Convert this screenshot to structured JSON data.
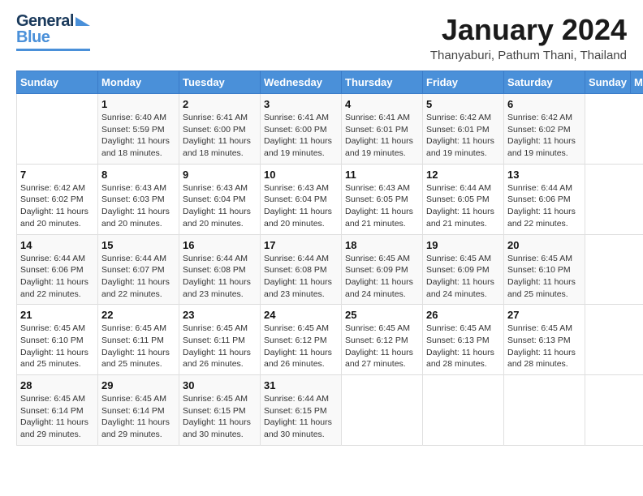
{
  "header": {
    "logo_line1": "General",
    "logo_line2": "Blue",
    "month_year": "January 2024",
    "location": "Thanyaburi, Pathum Thani, Thailand"
  },
  "calendar": {
    "weekdays": [
      "Sunday",
      "Monday",
      "Tuesday",
      "Wednesday",
      "Thursday",
      "Friday",
      "Saturday"
    ],
    "weeks": [
      [
        {
          "day": "",
          "info": ""
        },
        {
          "day": "1",
          "info": "Sunrise: 6:40 AM\nSunset: 5:59 PM\nDaylight: 11 hours\nand 18 minutes."
        },
        {
          "day": "2",
          "info": "Sunrise: 6:41 AM\nSunset: 6:00 PM\nDaylight: 11 hours\nand 18 minutes."
        },
        {
          "day": "3",
          "info": "Sunrise: 6:41 AM\nSunset: 6:00 PM\nDaylight: 11 hours\nand 19 minutes."
        },
        {
          "day": "4",
          "info": "Sunrise: 6:41 AM\nSunset: 6:01 PM\nDaylight: 11 hours\nand 19 minutes."
        },
        {
          "day": "5",
          "info": "Sunrise: 6:42 AM\nSunset: 6:01 PM\nDaylight: 11 hours\nand 19 minutes."
        },
        {
          "day": "6",
          "info": "Sunrise: 6:42 AM\nSunset: 6:02 PM\nDaylight: 11 hours\nand 19 minutes."
        }
      ],
      [
        {
          "day": "7",
          "info": "Sunrise: 6:42 AM\nSunset: 6:02 PM\nDaylight: 11 hours\nand 20 minutes."
        },
        {
          "day": "8",
          "info": "Sunrise: 6:43 AM\nSunset: 6:03 PM\nDaylight: 11 hours\nand 20 minutes."
        },
        {
          "day": "9",
          "info": "Sunrise: 6:43 AM\nSunset: 6:04 PM\nDaylight: 11 hours\nand 20 minutes."
        },
        {
          "day": "10",
          "info": "Sunrise: 6:43 AM\nSunset: 6:04 PM\nDaylight: 11 hours\nand 20 minutes."
        },
        {
          "day": "11",
          "info": "Sunrise: 6:43 AM\nSunset: 6:05 PM\nDaylight: 11 hours\nand 21 minutes."
        },
        {
          "day": "12",
          "info": "Sunrise: 6:44 AM\nSunset: 6:05 PM\nDaylight: 11 hours\nand 21 minutes."
        },
        {
          "day": "13",
          "info": "Sunrise: 6:44 AM\nSunset: 6:06 PM\nDaylight: 11 hours\nand 22 minutes."
        }
      ],
      [
        {
          "day": "14",
          "info": "Sunrise: 6:44 AM\nSunset: 6:06 PM\nDaylight: 11 hours\nand 22 minutes."
        },
        {
          "day": "15",
          "info": "Sunrise: 6:44 AM\nSunset: 6:07 PM\nDaylight: 11 hours\nand 22 minutes."
        },
        {
          "day": "16",
          "info": "Sunrise: 6:44 AM\nSunset: 6:08 PM\nDaylight: 11 hours\nand 23 minutes."
        },
        {
          "day": "17",
          "info": "Sunrise: 6:44 AM\nSunset: 6:08 PM\nDaylight: 11 hours\nand 23 minutes."
        },
        {
          "day": "18",
          "info": "Sunrise: 6:45 AM\nSunset: 6:09 PM\nDaylight: 11 hours\nand 24 minutes."
        },
        {
          "day": "19",
          "info": "Sunrise: 6:45 AM\nSunset: 6:09 PM\nDaylight: 11 hours\nand 24 minutes."
        },
        {
          "day": "20",
          "info": "Sunrise: 6:45 AM\nSunset: 6:10 PM\nDaylight: 11 hours\nand 25 minutes."
        }
      ],
      [
        {
          "day": "21",
          "info": "Sunrise: 6:45 AM\nSunset: 6:10 PM\nDaylight: 11 hours\nand 25 minutes."
        },
        {
          "day": "22",
          "info": "Sunrise: 6:45 AM\nSunset: 6:11 PM\nDaylight: 11 hours\nand 25 minutes."
        },
        {
          "day": "23",
          "info": "Sunrise: 6:45 AM\nSunset: 6:11 PM\nDaylight: 11 hours\nand 26 minutes."
        },
        {
          "day": "24",
          "info": "Sunrise: 6:45 AM\nSunset: 6:12 PM\nDaylight: 11 hours\nand 26 minutes."
        },
        {
          "day": "25",
          "info": "Sunrise: 6:45 AM\nSunset: 6:12 PM\nDaylight: 11 hours\nand 27 minutes."
        },
        {
          "day": "26",
          "info": "Sunrise: 6:45 AM\nSunset: 6:13 PM\nDaylight: 11 hours\nand 28 minutes."
        },
        {
          "day": "27",
          "info": "Sunrise: 6:45 AM\nSunset: 6:13 PM\nDaylight: 11 hours\nand 28 minutes."
        }
      ],
      [
        {
          "day": "28",
          "info": "Sunrise: 6:45 AM\nSunset: 6:14 PM\nDaylight: 11 hours\nand 29 minutes."
        },
        {
          "day": "29",
          "info": "Sunrise: 6:45 AM\nSunset: 6:14 PM\nDaylight: 11 hours\nand 29 minutes."
        },
        {
          "day": "30",
          "info": "Sunrise: 6:45 AM\nSunset: 6:15 PM\nDaylight: 11 hours\nand 30 minutes."
        },
        {
          "day": "31",
          "info": "Sunrise: 6:44 AM\nSunset: 6:15 PM\nDaylight: 11 hours\nand 30 minutes."
        },
        {
          "day": "",
          "info": ""
        },
        {
          "day": "",
          "info": ""
        },
        {
          "day": "",
          "info": ""
        }
      ]
    ]
  }
}
